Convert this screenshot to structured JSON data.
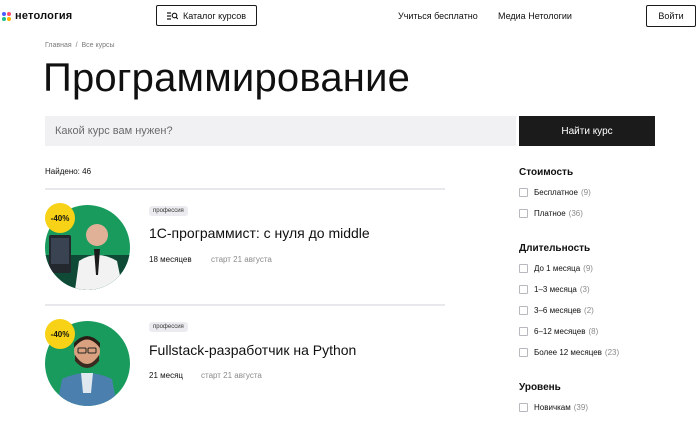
{
  "colors": {
    "accent_dark": "#1b1b1b",
    "discount_badge": "#f7d216",
    "photo_bg": "#1a9b5e",
    "search_bg": "#f1f1f4",
    "logo_dots": [
      "#4a5cff",
      "#ff4d6d",
      "#18c08f",
      "#ffb400"
    ]
  },
  "header": {
    "logo_text": "нетология",
    "catalog_label": "Каталог курсов",
    "catalog_icon": "filter-list-icon",
    "nav": [
      "Учиться бесплатно",
      "Медиа Нетологии"
    ],
    "login_label": "Войти"
  },
  "breadcrumb": [
    "Главная",
    "Все курсы"
  ],
  "breadcrumb_separator": "/",
  "page_title": "Программирование",
  "search": {
    "placeholder": "Какой курс вам нужен?",
    "button_label": "Найти курс"
  },
  "results": {
    "found_label": "Найдено: 46",
    "courses": [
      {
        "discount": "-40%",
        "tag": "профессия",
        "title": "1С-программист: с нуля до middle",
        "duration": "18 месяцев",
        "start": "старт 21 августа"
      },
      {
        "discount": "-40%",
        "tag": "профессия",
        "title": "Fullstack-разработчик на Python",
        "duration": "21 месяц",
        "start": "старт 21 августа"
      }
    ]
  },
  "filters": {
    "cost": {
      "heading": "Стоимость",
      "options": [
        {
          "label": "Бесплатное",
          "count": "(9)"
        },
        {
          "label": "Платное",
          "count": "(36)"
        }
      ]
    },
    "duration": {
      "heading": "Длительность",
      "options": [
        {
          "label": "До 1 месяца",
          "count": "(9)"
        },
        {
          "label": "1–3 месяца",
          "count": "(3)"
        },
        {
          "label": "3–6 месяцев",
          "count": "(2)"
        },
        {
          "label": "6–12 месяцев",
          "count": "(8)"
        },
        {
          "label": "Более 12 месяцев",
          "count": "(23)"
        }
      ]
    },
    "level": {
      "heading": "Уровень",
      "options": [
        {
          "label": "Новичкам",
          "count": "(39)"
        }
      ]
    }
  }
}
